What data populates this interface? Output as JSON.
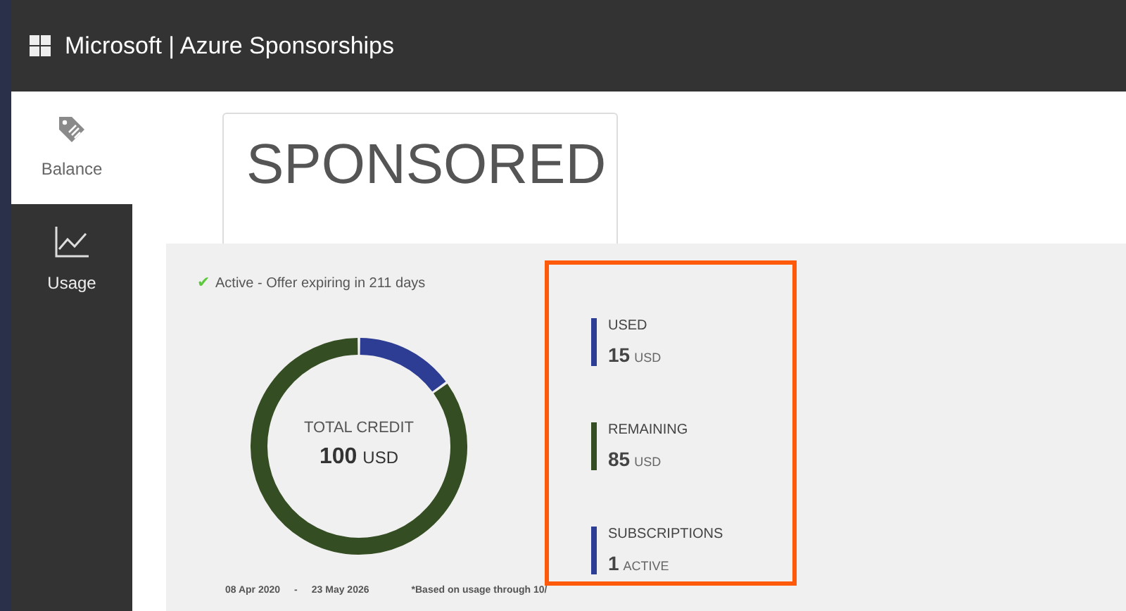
{
  "header": {
    "title": "Microsoft | Azure Sponsorships"
  },
  "sidebar": {
    "items": [
      {
        "label": "Balance",
        "kind": "tag",
        "selected": true
      },
      {
        "label": "Usage",
        "kind": "chart",
        "selected": false
      }
    ]
  },
  "banner": {
    "title": "SPONSORED"
  },
  "status": {
    "icon": "✔",
    "text": "Active - Offer expiring in 211 days"
  },
  "donut": {
    "label": "TOTAL CREDIT",
    "value": "100",
    "unit": "USD"
  },
  "dates": {
    "start": "08 Apr 2020",
    "separator": "-",
    "end": "23 May 2026",
    "note": "*Based on usage through 10/"
  },
  "stats": [
    {
      "label": "USED",
      "value": "15",
      "unit": "USD",
      "color": "#2e3d94"
    },
    {
      "label": "REMAINING",
      "value": "85",
      "unit": "USD",
      "color": "#354d22"
    },
    {
      "label": "SUBSCRIPTIONS",
      "value": "1",
      "unit": "ACTIVE",
      "color": "#2e3d94"
    }
  ]
}
